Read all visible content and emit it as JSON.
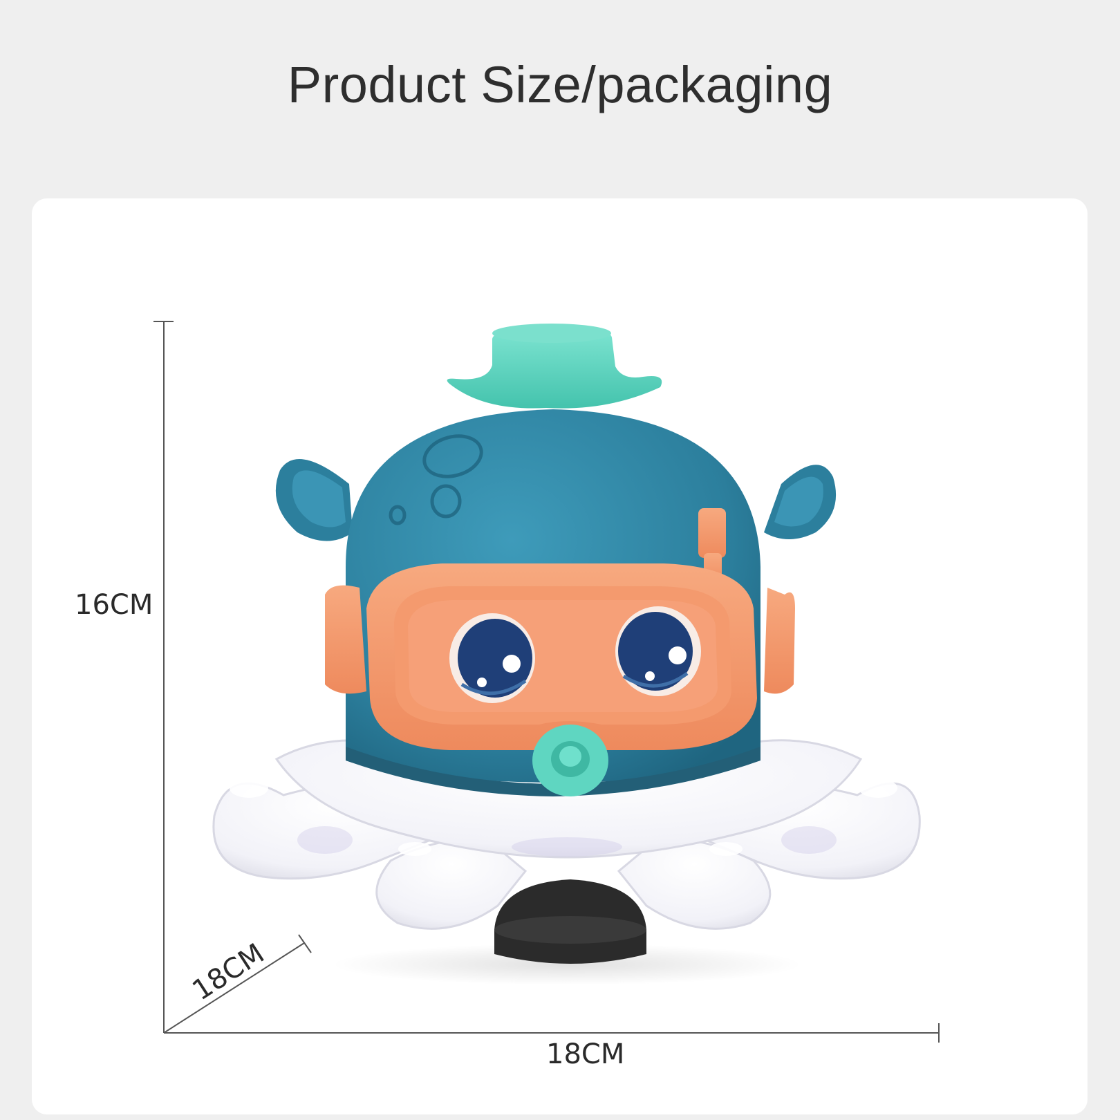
{
  "title": "Product Size/packaging",
  "dimensions": {
    "height": "16CM",
    "depth": "18CM",
    "width": "18CM"
  },
  "colors": {
    "page_background": "#efefef",
    "card_background": "#ffffff",
    "head": "#2c7f9d",
    "goggles": "#f49a6e",
    "hat": "#5fd6c1",
    "tentacles": "#ffffff",
    "eyes": "#1f3f78"
  },
  "product_image": {
    "icon": "octopus-toy-icon"
  }
}
